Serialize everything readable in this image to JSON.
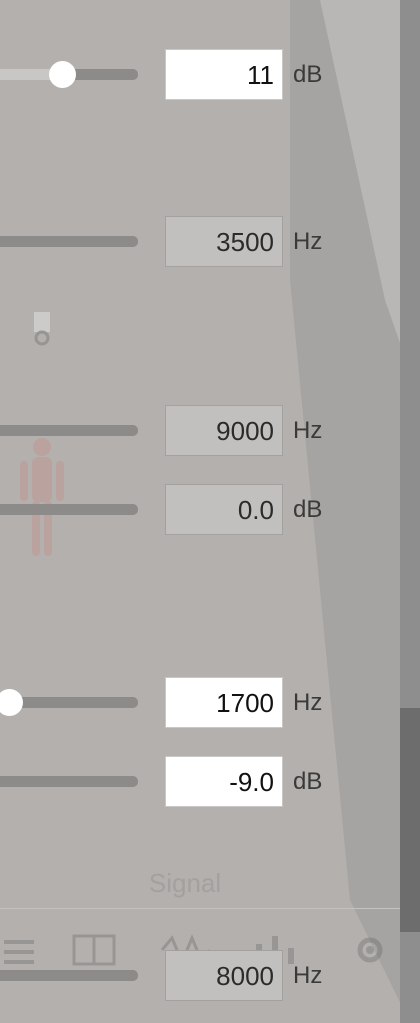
{
  "controls": [
    {
      "value": "11",
      "unit": "dB",
      "active": true,
      "slider": 0.45
    },
    {
      "value": "3500",
      "unit": "Hz",
      "active": false,
      "slider": 0
    },
    {
      "value": "9000",
      "unit": "Hz",
      "active": false,
      "slider": 0
    },
    {
      "value": "0.0",
      "unit": "dB",
      "active": false,
      "slider": 0
    },
    {
      "value": "1700",
      "unit": "Hz",
      "active": true,
      "slider": 0.05
    },
    {
      "value": "-9.0",
      "unit": "dB",
      "active": true,
      "slider": 0
    },
    {
      "value": "8000",
      "unit": "Hz",
      "active": false,
      "slider": 0
    }
  ],
  "signal": {
    "label": "Signal"
  },
  "toolbar": {
    "icons": [
      "list-icon",
      "grid-icon",
      "waveform-icon",
      "bars-icon",
      "gear-icon"
    ]
  },
  "colors": {
    "accent_white": "#ffffff",
    "background": "#b3b0ad"
  }
}
